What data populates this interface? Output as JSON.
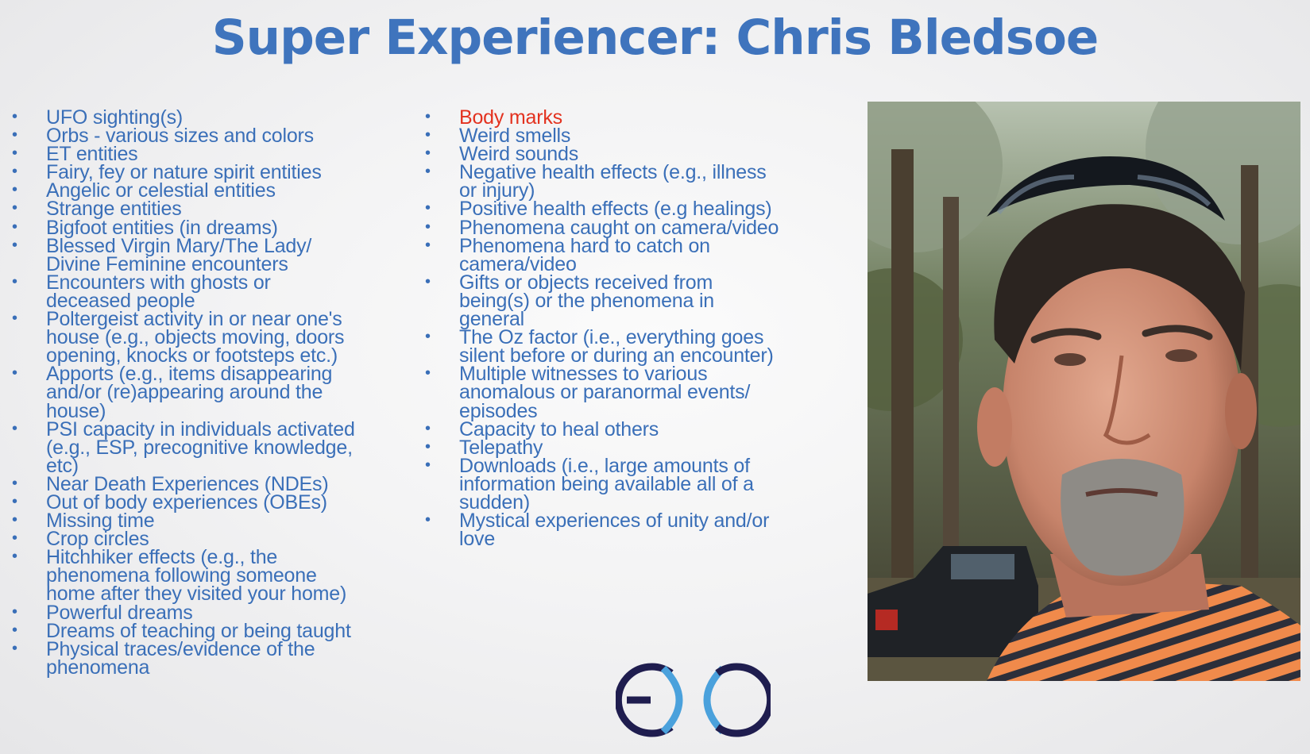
{
  "slide": {
    "title": "Super Experiencer: Chris Bledsoe",
    "photo_subject": "Chris Bledsoe",
    "logo_text": "EC",
    "colors": {
      "title": "#3f74bd",
      "text": "#3a6fb8",
      "highlight": "#e3321f"
    },
    "bullet_symbol": "•"
  },
  "column1": [
    {
      "text": "UFO sighting(s)"
    },
    {
      "text": "Orbs - various sizes and colors"
    },
    {
      "text": "ET entities"
    },
    {
      "text": "Fairy, fey or nature spirit entities"
    },
    {
      "text": "Angelic or celestial entities"
    },
    {
      "text": "Strange entities"
    },
    {
      "text": "Bigfoot entities (in dreams)"
    },
    {
      "text": "Blessed Virgin Mary/The Lady/",
      "cont": "Divine Feminine encounters"
    },
    {
      "text": "Encounters with ghosts or",
      "cont": "deceased people"
    },
    {
      "text": "Poltergeist activity in or near one's",
      "cont": "house (e.g., objects moving, doors",
      "cont2": "opening, knocks or footsteps etc.)"
    },
    {
      "text": "Apports (e.g., items disappearing",
      "cont": "and/or (re)appearing around the",
      "cont2": "house)"
    },
    {
      "text": "PSI capacity in individuals activated",
      "cont": "(e.g., ESP, precognitive knowledge,",
      "cont2": "etc)"
    },
    {
      "text": "Near Death Experiences (NDEs)"
    },
    {
      "text": "Out of body experiences (OBEs)"
    },
    {
      "text": "Missing time"
    },
    {
      "text": "Crop circles"
    },
    {
      "text": "Hitchhiker effects (e.g., the",
      "cont": "phenomena following someone",
      "cont2": "home after they visited your home)"
    },
    {
      "text": "Powerful dreams"
    },
    {
      "text": "Dreams of teaching or being taught"
    },
    {
      "text": "Physical traces/evidence of the",
      "cont": "phenomena"
    }
  ],
  "column2": [
    {
      "text": "Body marks",
      "highlight": true
    },
    {
      "text": "Weird smells"
    },
    {
      "text": "Weird sounds"
    },
    {
      "text": "Negative health effects (e.g., illness",
      "cont": "or injury)"
    },
    {
      "text": "Positive health effects (e.g healings)"
    },
    {
      "text": "Phenomena caught on camera/video"
    },
    {
      "text": "Phenomena hard to catch on",
      "cont": "camera/video"
    },
    {
      "text": "Gifts or objects received from",
      "cont": "being(s) or the phenomena in",
      "cont2": "general"
    },
    {
      "text": "The Oz factor (i.e., everything goes",
      "cont": "silent before or during an encounter)"
    },
    {
      "text": "Multiple witnesses to various",
      "cont": "anomalous or paranormal events/",
      "cont2": "episodes"
    },
    {
      "text": "Capacity to heal others"
    },
    {
      "text": "Telepathy"
    },
    {
      "text": "Downloads (i.e., large amounts of",
      "cont": "information being available all of a",
      "cont2": "sudden)"
    },
    {
      "text": "Mystical experiences of unity and/or",
      "cont": "love"
    }
  ]
}
